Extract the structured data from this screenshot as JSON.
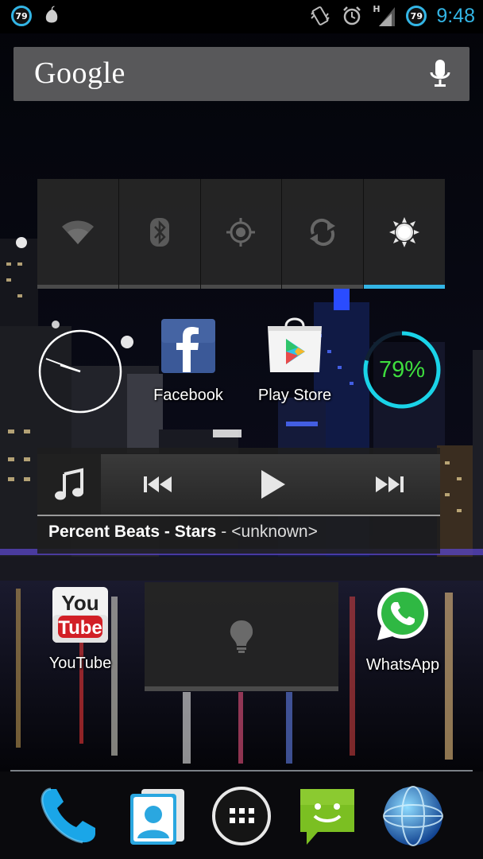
{
  "status_bar": {
    "left_badge": "79",
    "right_badge": "79",
    "network_type": "H",
    "time": "9:48",
    "icons": [
      "battery-badge-icon",
      "pear-icon",
      "vibrate-icon",
      "alarm-icon",
      "signal-icon",
      "battery-badge-icon"
    ]
  },
  "search": {
    "logo": "Google",
    "voice_icon": "microphone-icon"
  },
  "power_widget": {
    "toggles": [
      {
        "name": "wifi",
        "icon": "wifi-icon",
        "active": false
      },
      {
        "name": "bluetooth",
        "icon": "bluetooth-icon",
        "active": false
      },
      {
        "name": "gps",
        "icon": "gps-icon",
        "active": false
      },
      {
        "name": "sync",
        "icon": "sync-icon",
        "active": false
      },
      {
        "name": "brightness",
        "icon": "brightness-icon",
        "active": true
      }
    ],
    "accent": "#33b5e5"
  },
  "home_apps": {
    "facebook": {
      "label": "Facebook",
      "icon": "facebook-icon"
    },
    "play_store": {
      "label": "Play Store",
      "icon": "play-store-icon"
    },
    "youtube": {
      "label": "YouTube",
      "icon": "youtube-icon",
      "logo_top": "You",
      "logo_bottom": "Tube"
    },
    "whatsapp": {
      "label": "WhatsApp",
      "icon": "whatsapp-icon"
    }
  },
  "battery_widget": {
    "percent_text": "79%",
    "level": 0.79,
    "ring_color": "#1ad3e8",
    "text_color": "#3ede3e"
  },
  "music_widget": {
    "title": "Percent Beats - Stars",
    "separator": "-",
    "artist": "<unknown>",
    "icons": [
      "music-note-icon",
      "previous-icon",
      "play-icon",
      "next-icon"
    ]
  },
  "torch_widget": {
    "icon": "lightbulb-icon"
  },
  "dock": {
    "items": [
      "phone-icon",
      "contacts-icon",
      "app-drawer-icon",
      "messaging-icon",
      "browser-icon"
    ]
  }
}
